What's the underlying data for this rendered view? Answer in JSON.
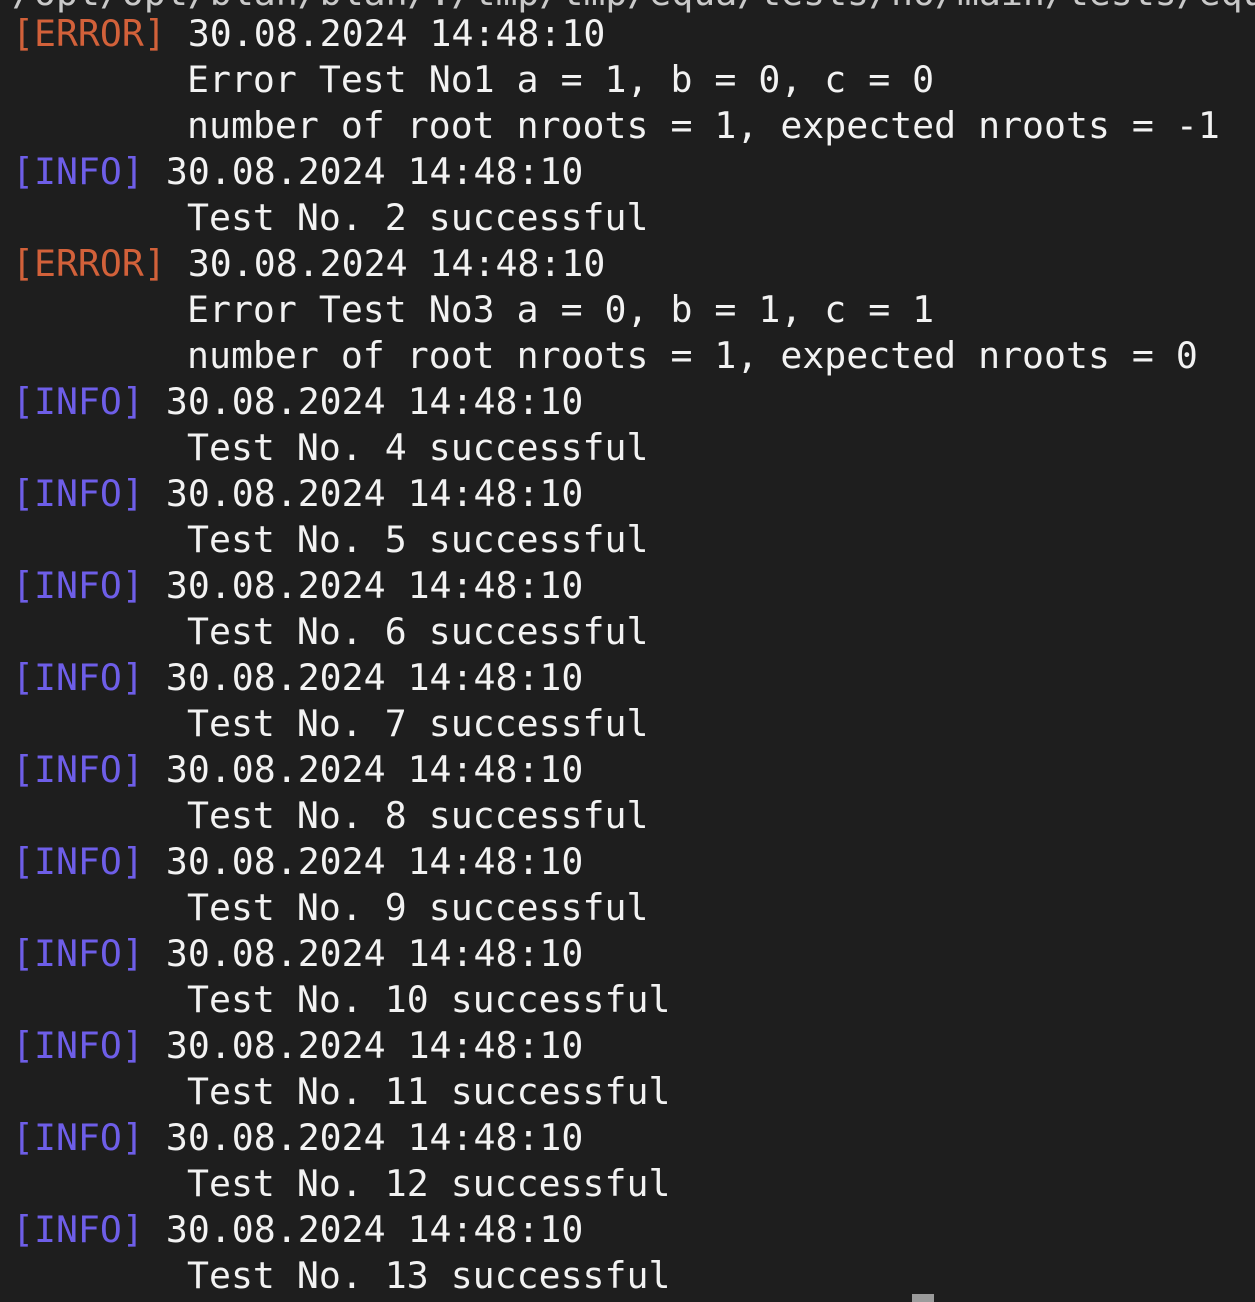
{
  "terminal": {
    "cut_top_line": "/opt/opt/blah/blah/./tmp/tmp/equa/tests/no/main/tests/equa.c",
    "colors": {
      "background": "#1e1e1e",
      "text": "#f2f2f2",
      "error_tag": "#d2613a",
      "info_tag": "#6e5ee8",
      "cursor": "#9b9b9b"
    },
    "entries": [
      {
        "level": "error",
        "tag": "[ERROR]",
        "timestamp": "30.08.2024 14:48:10",
        "messages": [
          "Error Test No1 a = 1, b = 0, c = 0",
          "number of root nroots = 1, expected nroots = -1"
        ]
      },
      {
        "level": "info",
        "tag": "[INFO]",
        "timestamp": "30.08.2024 14:48:10",
        "messages": [
          "Test No. 2 successful"
        ]
      },
      {
        "level": "error",
        "tag": "[ERROR]",
        "timestamp": "30.08.2024 14:48:10",
        "messages": [
          "Error Test No3 a = 0, b = 1, c = 1",
          "number of root nroots = 1, expected nroots = 0"
        ]
      },
      {
        "level": "info",
        "tag": "[INFO]",
        "timestamp": "30.08.2024 14:48:10",
        "messages": [
          "Test No. 4 successful"
        ]
      },
      {
        "level": "info",
        "tag": "[INFO]",
        "timestamp": "30.08.2024 14:48:10",
        "messages": [
          "Test No. 5 successful"
        ]
      },
      {
        "level": "info",
        "tag": "[INFO]",
        "timestamp": "30.08.2024 14:48:10",
        "messages": [
          "Test No. 6 successful"
        ]
      },
      {
        "level": "info",
        "tag": "[INFO]",
        "timestamp": "30.08.2024 14:48:10",
        "messages": [
          "Test No. 7 successful"
        ]
      },
      {
        "level": "info",
        "tag": "[INFO]",
        "timestamp": "30.08.2024 14:48:10",
        "messages": [
          "Test No. 8 successful"
        ]
      },
      {
        "level": "info",
        "tag": "[INFO]",
        "timestamp": "30.08.2024 14:48:10",
        "messages": [
          "Test No. 9 successful"
        ]
      },
      {
        "level": "info",
        "tag": "[INFO]",
        "timestamp": "30.08.2024 14:48:10",
        "messages": [
          "Test No. 10 successful"
        ]
      },
      {
        "level": "info",
        "tag": "[INFO]",
        "timestamp": "30.08.2024 14:48:10",
        "messages": [
          "Test No. 11 successful"
        ]
      },
      {
        "level": "info",
        "tag": "[INFO]",
        "timestamp": "30.08.2024 14:48:10",
        "messages": [
          "Test No. 12 successful"
        ]
      },
      {
        "level": "info",
        "tag": "[INFO]",
        "timestamp": "30.08.2024 14:48:10",
        "messages": [
          "Test No. 13 successful"
        ]
      }
    ]
  }
}
